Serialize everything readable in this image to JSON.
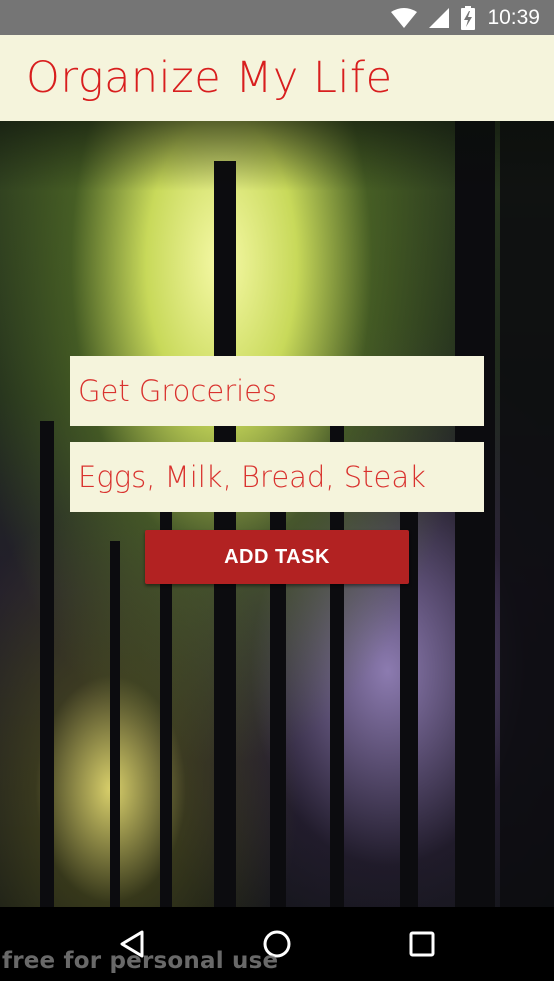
{
  "status_bar": {
    "time": "10:39",
    "icons": [
      "wifi-icon",
      "signal-icon",
      "battery-icon"
    ],
    "bg_color": "#757575"
  },
  "app_bar": {
    "title": "Organize My Life",
    "title_color": "#d81e1e",
    "bg_color": "#f5f4dc"
  },
  "form": {
    "task_title_value": "Get Groceries",
    "task_details_value": "Eggs, Milk, Bread, Steak",
    "add_button_label": "ADD TASK",
    "button_color": "#b22222"
  },
  "nav_bar": {
    "buttons": [
      "back-icon",
      "home-icon",
      "recents-icon"
    ]
  },
  "watermark": "free for personal use"
}
